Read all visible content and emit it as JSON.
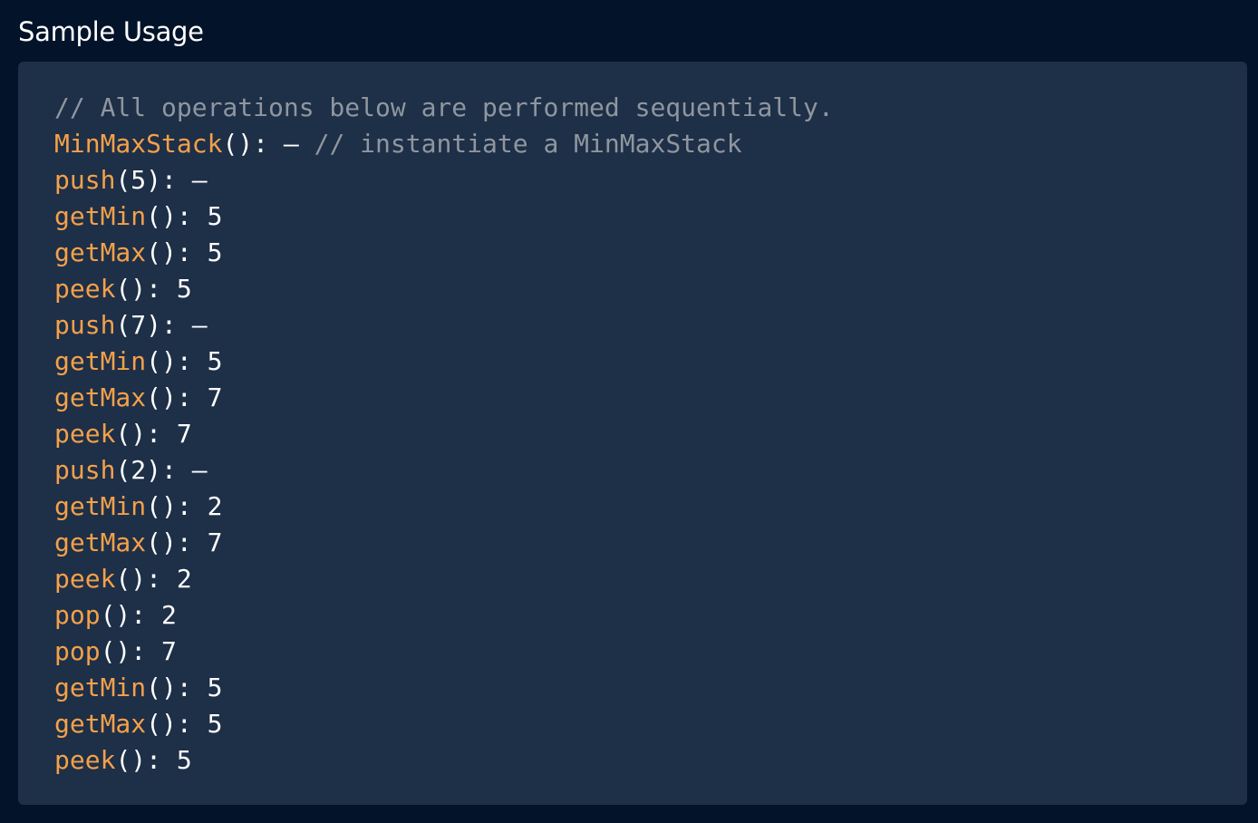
{
  "section": {
    "title": "Sample Usage"
  },
  "colors": {
    "page_background": "#03132a",
    "panel_background": "#1e2f48",
    "function_name": "#f3a14a",
    "text": "#ffffff",
    "comment": "#8f969e"
  },
  "code": {
    "lines": [
      {
        "comment": "// All operations below are performed sequentially."
      },
      {
        "fn": "MinMaxStack",
        "args": "()",
        "result": "–",
        "comment": "// instantiate a MinMaxStack"
      },
      {
        "fn": "push",
        "args": "(5)",
        "result": "–"
      },
      {
        "fn": "getMin",
        "args": "()",
        "result": "5"
      },
      {
        "fn": "getMax",
        "args": "()",
        "result": "5"
      },
      {
        "fn": "peek",
        "args": "()",
        "result": "5"
      },
      {
        "fn": "push",
        "args": "(7)",
        "result": "–"
      },
      {
        "fn": "getMin",
        "args": "()",
        "result": "5"
      },
      {
        "fn": "getMax",
        "args": "()",
        "result": "7"
      },
      {
        "fn": "peek",
        "args": "()",
        "result": "7"
      },
      {
        "fn": "push",
        "args": "(2)",
        "result": "–"
      },
      {
        "fn": "getMin",
        "args": "()",
        "result": "2"
      },
      {
        "fn": "getMax",
        "args": "()",
        "result": "7"
      },
      {
        "fn": "peek",
        "args": "()",
        "result": "2"
      },
      {
        "fn": "pop",
        "args": "()",
        "result": "2"
      },
      {
        "fn": "pop",
        "args": "()",
        "result": "7"
      },
      {
        "fn": "getMin",
        "args": "()",
        "result": "5"
      },
      {
        "fn": "getMax",
        "args": "()",
        "result": "5"
      },
      {
        "fn": "peek",
        "args": "()",
        "result": "5"
      }
    ]
  }
}
